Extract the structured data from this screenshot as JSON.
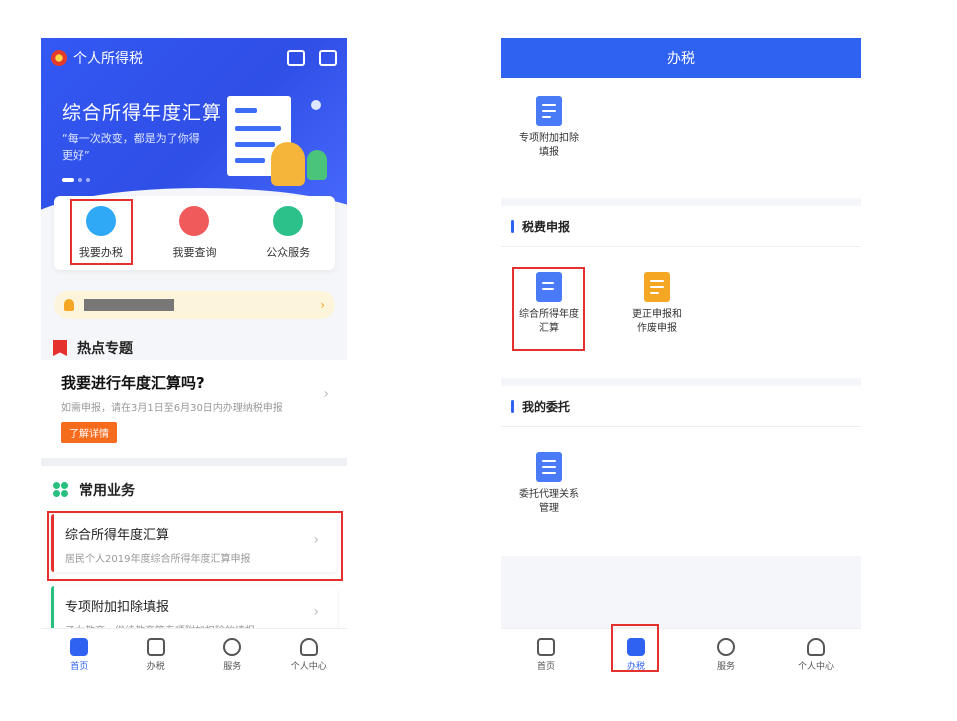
{
  "left": {
    "app_title": "个人所得税",
    "hero_title": "综合所得年度汇算",
    "hero_subtitle": "“每一次改变，都是为了你得更好”",
    "quick_actions": [
      {
        "label": "我要办税",
        "icon": "edit-icon",
        "color": "#2fa8f5"
      },
      {
        "label": "我要查询",
        "icon": "search-icon",
        "color": "#f05a5a"
      },
      {
        "label": "公众服务",
        "icon": "service-icon",
        "color": "#2cc08a"
      }
    ],
    "hot_topics": {
      "header": "热点专题",
      "title": "我要进行年度汇算吗?",
      "desc": "如需申报，请在3月1日至6月30日内办理纳税申报",
      "button": "了解详情"
    },
    "common_business": {
      "header": "常用业务",
      "items": [
        {
          "title": "综合所得年度汇算",
          "desc": "居民个人2019年度综合所得年度汇算申报",
          "accent": "#e5312e"
        },
        {
          "title": "专项附加扣除填报",
          "desc": "子女教育、继续教育等专项附加扣除的填报",
          "accent": "#28c081"
        }
      ]
    },
    "tabs": [
      {
        "label": "首页",
        "icon": "home-icon",
        "active": true
      },
      {
        "label": "办税",
        "icon": "tax-icon",
        "active": false
      },
      {
        "label": "服务",
        "icon": "heart-icon",
        "active": false
      },
      {
        "label": "个人中心",
        "icon": "user-icon",
        "active": false
      }
    ]
  },
  "right": {
    "header_title": "办税",
    "top_service": {
      "label_line1": "专项附加扣除",
      "label_line2": "填报"
    },
    "section_tax": "税费申报",
    "tax_services": [
      {
        "label_line1": "综合所得年度",
        "label_line2": "汇算",
        "color": "#4a7bf7"
      },
      {
        "label_line1": "更正申报和",
        "label_line2": "作废申报",
        "color": "#f5a623"
      }
    ],
    "section_delegate": "我的委托",
    "delegate_service": {
      "label_line1": "委托代理关系",
      "label_line2": "管理"
    },
    "tabs": [
      {
        "label": "首页",
        "icon": "home-icon",
        "active": false
      },
      {
        "label": "办税",
        "icon": "tax-icon",
        "active": true
      },
      {
        "label": "服务",
        "icon": "heart-icon",
        "active": false
      },
      {
        "label": "个人中心",
        "icon": "user-icon",
        "active": false
      }
    ]
  }
}
